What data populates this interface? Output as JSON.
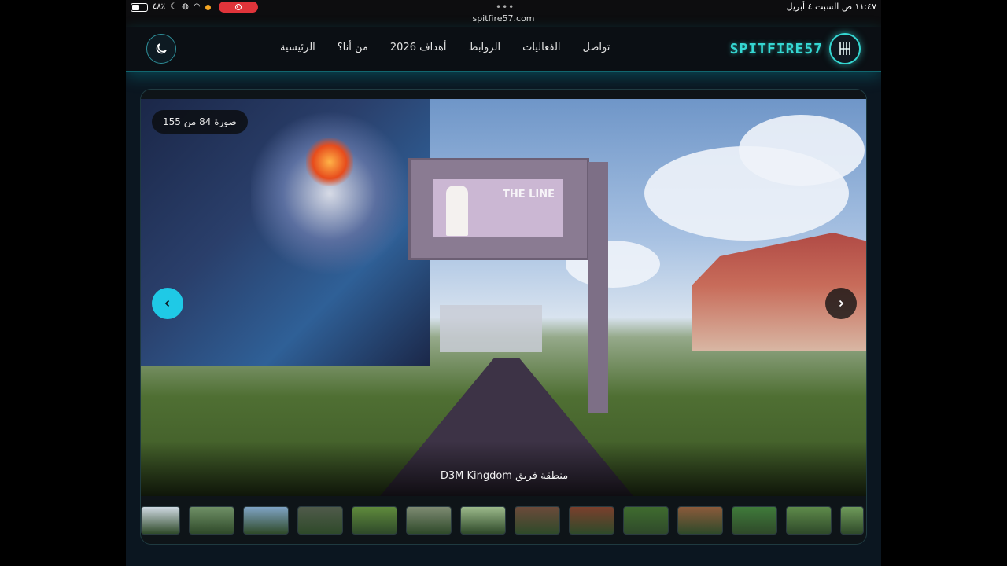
{
  "statusbar": {
    "battery": "٤٨٪",
    "datetime": "١١:٤٧ ص   السبت ٤ أبريل",
    "url": "spitfire57.com",
    "dots": "•••"
  },
  "navbar": {
    "brand": "SPITFIRE57",
    "links": [
      "الرئيسية",
      "من أنا؟",
      "أهداف 2026",
      "الروابط",
      "الفعاليات",
      "تواصل"
    ]
  },
  "gallery": {
    "counter": "صورة 84 من 155",
    "caption": "منطقة فريق D3M Kingdom",
    "billboard_text": "THE LINE",
    "thumb_colors": [
      "#cfd9e2",
      "#6f8f66",
      "#7fa3c4",
      "#4f5a4a",
      "#5f8a3c",
      "#7d8a72",
      "#9bb98a",
      "#6b4a3a",
      "#7a3f2c",
      "#3f6b2f",
      "#8a5a3b",
      "#3f7a3a",
      "#5e8a4a",
      "#6f9a5a"
    ]
  }
}
